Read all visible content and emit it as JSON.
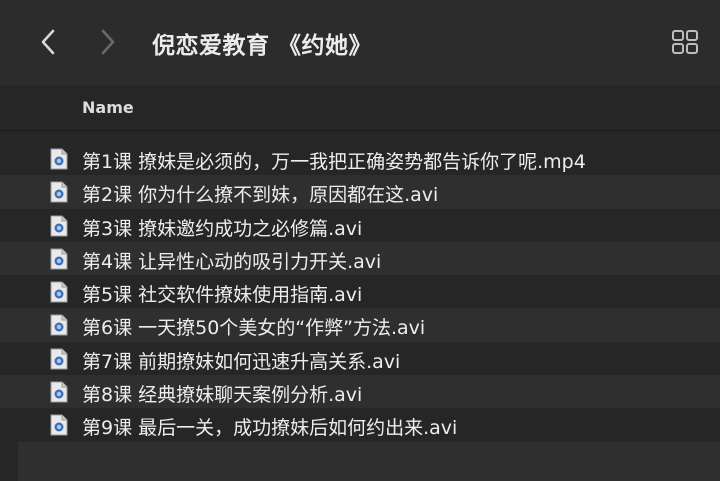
{
  "window": {
    "title": "倪恋爱教育 《约她》"
  },
  "toolbar": {
    "back_icon": "chevron-left-icon",
    "forward_icon": "chevron-right-icon",
    "view_icon": "grid-view-icon"
  },
  "columns": {
    "name": "Name"
  },
  "files": [
    {
      "name": "第1课 撩妹是必须的，万一我把正确姿势都告诉你了呢.mp4"
    },
    {
      "name": "第2课 你为什么撩不到妹，原因都在这.avi"
    },
    {
      "name": "第3课 撩妹邀约成功之必修篇.avi"
    },
    {
      "name": "第4课 让异性心动的吸引力开关.avi"
    },
    {
      "name": "第5课 社交软件撩妹使用指南.avi"
    },
    {
      "name": "第6课 一天撩50个美女的“作弊”方法.avi"
    },
    {
      "name": "第7课 前期撩妹如何迅速升高关系.avi"
    },
    {
      "name": "第8课 经典撩妹聊天案例分析.avi"
    },
    {
      "name": "第9课 最后一关，成功撩妹后如何约出来.avi"
    }
  ]
}
